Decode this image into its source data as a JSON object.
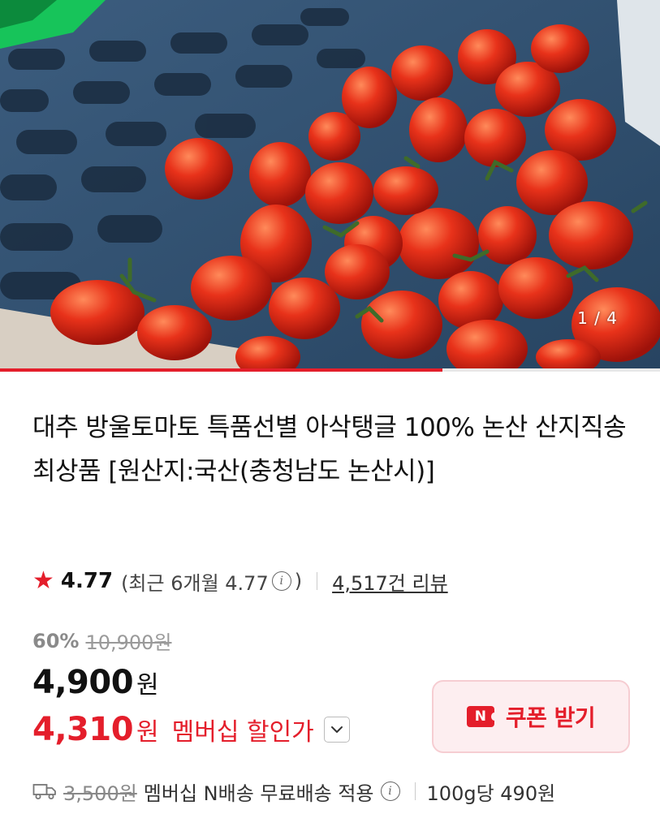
{
  "gallery": {
    "current": "1",
    "separator": "/",
    "total": "4",
    "progress_fraction": 0.67
  },
  "product": {
    "title": "대추 방울토마토 특품선별 아삭탱글 100% 논산 산지직송 최상품 [원산지:국산(충청남도 논산시)]"
  },
  "rating": {
    "star_icon": "star-icon",
    "score": "4.77",
    "recent_prefix": "(최근 6개월 4.77",
    "recent_suffix": ")",
    "review_count": "4,517건 리뷰"
  },
  "price": {
    "discount_rate": "60%",
    "original_price": "10,900원",
    "sale_price": "4,900",
    "sale_unit": "원",
    "member_price": "4,310",
    "member_unit": "원",
    "member_label": "멤버십 할인가"
  },
  "coupon": {
    "icon_text": "N",
    "label": "쿠폰 받기"
  },
  "shipping": {
    "original_fee": "3,500원",
    "description": "멤버십 N배송 무료배송 적용",
    "unit_price": "100g당 490원"
  },
  "colors": {
    "accent": "#e41e2b",
    "coupon_bg": "#fdeef0"
  }
}
